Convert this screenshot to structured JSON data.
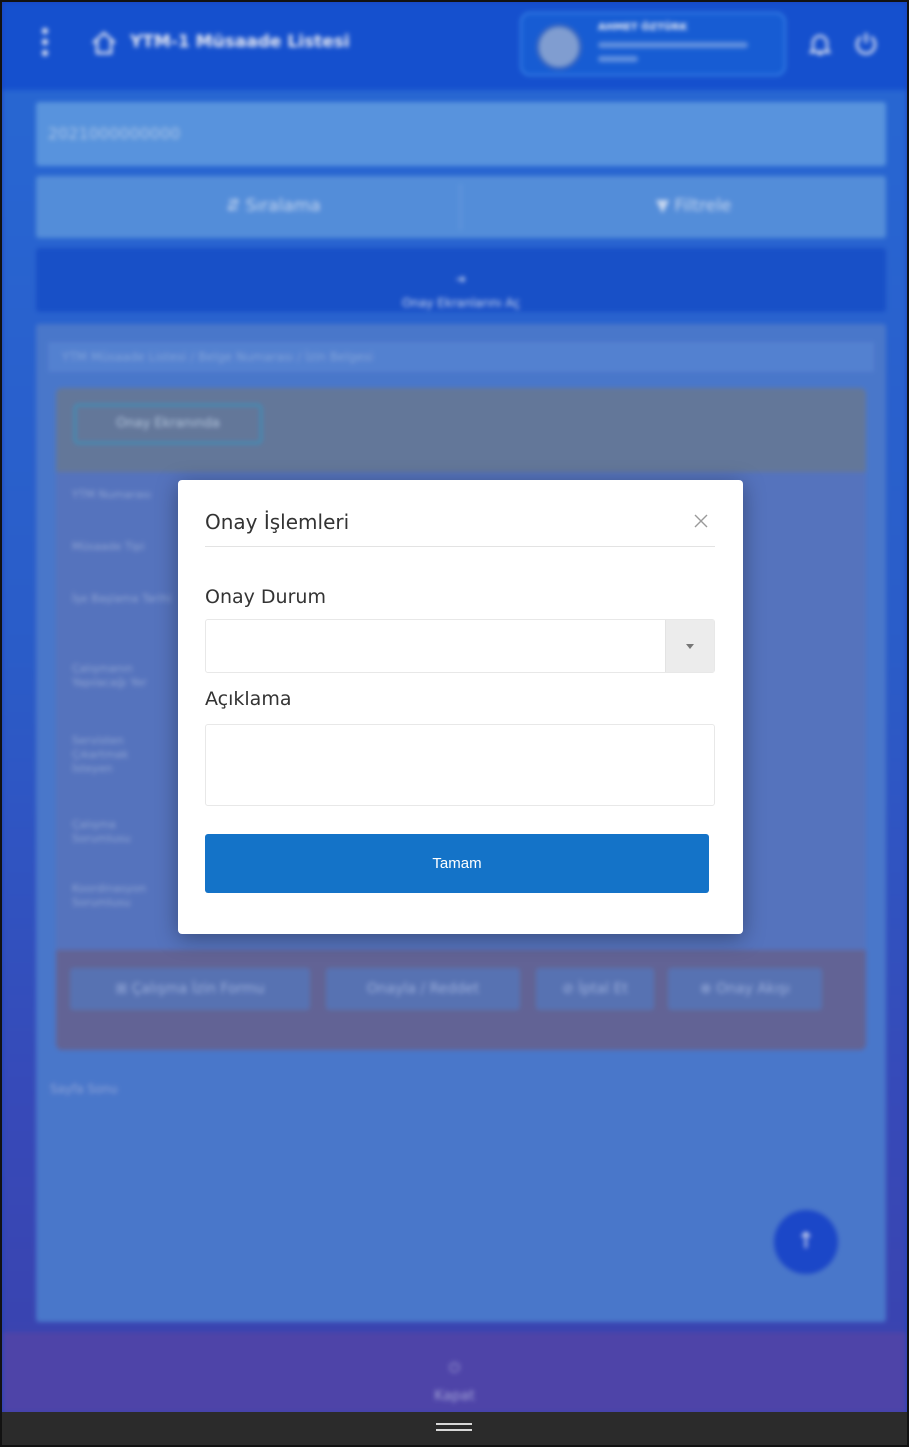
{
  "app": {
    "title": "YTM-1 Müsaade Listesi",
    "user_name": "AHMET ÖZTÜRK",
    "search_value": "2021000000000",
    "sort_label": "Sıralama",
    "filter_label": "Filtrele",
    "approve_screen_button": "Onay Ekranlarını Aç",
    "info_line": "YTM Müsaade Listesi / Belge Numarası / İzin Belgesi",
    "panel_chip": "Onay Ekranında",
    "rows": [
      "YTM Numarası",
      "Müsaade Tipi",
      "İşe Başlama Tarihi",
      "Çalışmanın Yapılacağı Yer",
      "Servisten Çıkartmak İsteyen",
      "Çalışma Sorumlusu",
      "Koordinasyon Sorumlusu"
    ],
    "footer_buttons": [
      "Çalışma İzin Formu",
      "Onayla / Reddet",
      "İptal Et",
      "Onay Akışı"
    ],
    "page_info": "Sayfa Sonu",
    "close_label": "Kapat"
  },
  "modal": {
    "title": "Onay İşlemleri",
    "status_label": "Onay Durum",
    "status_value": "",
    "description_label": "Açıklama",
    "description_value": "",
    "ok_label": "Tamam"
  },
  "colors": {
    "topbar": "#1655d6",
    "ok_button": "#1473c8"
  }
}
